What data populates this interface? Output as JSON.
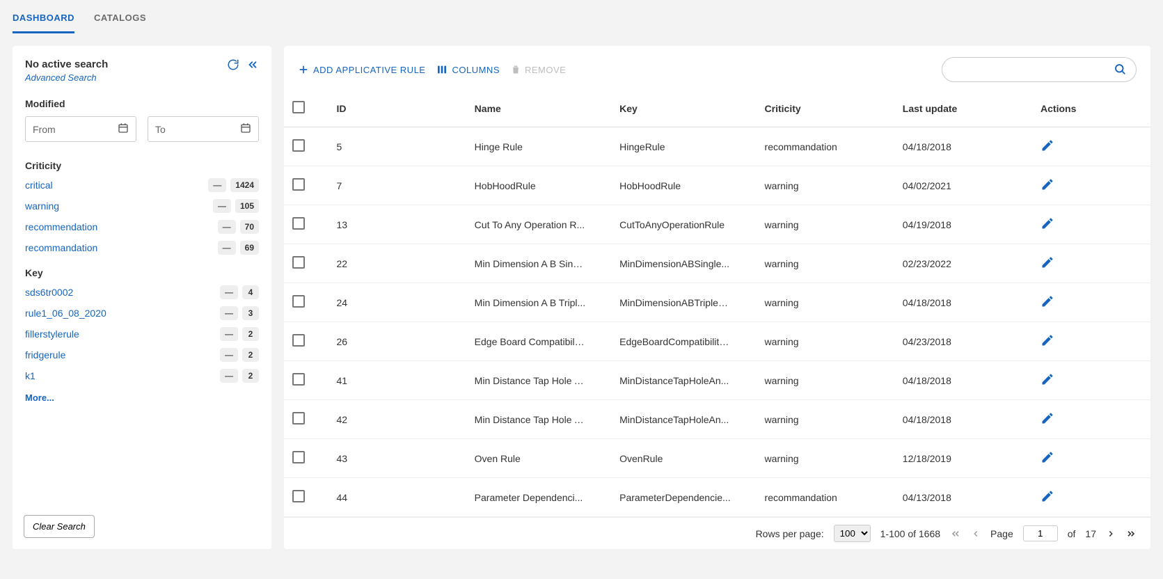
{
  "tabs": [
    {
      "label": "DASHBOARD",
      "active": true
    },
    {
      "label": "CATALOGS",
      "active": false
    }
  ],
  "sidebar": {
    "title": "No active search",
    "advanced_link": "Advanced Search",
    "modified_title": "Modified",
    "from_placeholder": "From",
    "to_placeholder": "To",
    "criticity_title": "Criticity",
    "criticity_items": [
      {
        "label": "critical",
        "count": "1424"
      },
      {
        "label": "warning",
        "count": "105"
      },
      {
        "label": "recommendation",
        "count": "70"
      },
      {
        "label": "recommandation",
        "count": "69"
      }
    ],
    "key_title": "Key",
    "key_items": [
      {
        "label": "sds6tr0002",
        "count": "4"
      },
      {
        "label": "rule1_06_08_2020",
        "count": "3"
      },
      {
        "label": "fillerstylerule",
        "count": "2"
      },
      {
        "label": "fridgerule",
        "count": "2"
      },
      {
        "label": "k1",
        "count": "2"
      }
    ],
    "more_label": "More...",
    "clear_label": "Clear Search"
  },
  "toolbar": {
    "add_label": "ADD APPLICATIVE RULE",
    "columns_label": "COLUMNS",
    "remove_label": "REMOVE"
  },
  "columns": [
    "ID",
    "Name",
    "Key",
    "Criticity",
    "Last update",
    "Actions"
  ],
  "rows": [
    {
      "id": "5",
      "name": "Hinge Rule",
      "key": "HingeRule",
      "crit": "recommandation",
      "date": "04/18/2018"
    },
    {
      "id": "7",
      "name": "HobHoodRule",
      "key": "HobHoodRule",
      "crit": "warning",
      "date": "04/02/2021"
    },
    {
      "id": "13",
      "name": "Cut To Any Operation R...",
      "key": "CutToAnyOperationRule",
      "crit": "warning",
      "date": "04/19/2018"
    },
    {
      "id": "22",
      "name": "Min Dimension A B Singl...",
      "key": "MinDimensionABSingle...",
      "crit": "warning",
      "date": "02/23/2022"
    },
    {
      "id": "24",
      "name": "Min Dimension A B Tripl...",
      "key": "MinDimensionABTripleC...",
      "crit": "warning",
      "date": "04/18/2018"
    },
    {
      "id": "26",
      "name": "Edge Board Compatibilit...",
      "key": "EdgeBoardCompatibility...",
      "crit": "warning",
      "date": "04/23/2018"
    },
    {
      "id": "41",
      "name": "Min Distance Tap Hole A...",
      "key": "MinDistanceTapHoleAn...",
      "crit": "warning",
      "date": "04/18/2018"
    },
    {
      "id": "42",
      "name": "Min Distance Tap Hole A...",
      "key": "MinDistanceTapHoleAn...",
      "crit": "warning",
      "date": "04/18/2018"
    },
    {
      "id": "43",
      "name": "Oven Rule",
      "key": "OvenRule",
      "crit": "warning",
      "date": "12/18/2019"
    },
    {
      "id": "44",
      "name": "Parameter Dependenci...",
      "key": "ParameterDependencie...",
      "crit": "recommandation",
      "date": "04/13/2018"
    }
  ],
  "pager": {
    "rows_per_page_label": "Rows per page:",
    "rows_per_page_value": "100",
    "range_text": "1-100 of 1668",
    "page_label": "Page",
    "page_value": "1",
    "of_label": "of",
    "total_pages": "17"
  }
}
